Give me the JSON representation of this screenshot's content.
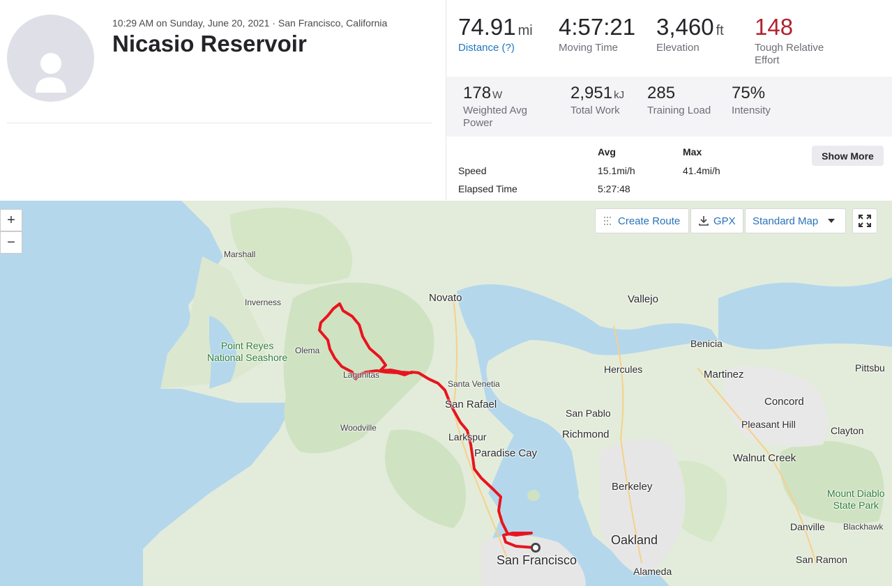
{
  "activity": {
    "meta": "10:29 AM on Sunday, June 20, 2021 · San Francisco, California",
    "title": "Nicasio Reservoir"
  },
  "stats_primary": [
    {
      "value": "74.91",
      "unit": "mi",
      "label": "Distance (?)"
    },
    {
      "value": "4:57:21",
      "unit": "",
      "label": "Moving Time"
    },
    {
      "value": "3,460",
      "unit": "ft",
      "label": "Elevation"
    },
    {
      "value": "148",
      "unit": "",
      "label_line1": "Tough Relative",
      "label_line2": "Effort"
    }
  ],
  "stats_secondary": [
    {
      "value": "178",
      "unit": "W",
      "label_line1": "Weighted Avg",
      "label_line2": "Power"
    },
    {
      "value": "2,951",
      "unit": "kJ",
      "label": "Total Work"
    },
    {
      "value": "285",
      "unit": "",
      "label": "Training Load"
    },
    {
      "value": "75%",
      "unit": "",
      "label": "Intensity"
    }
  ],
  "more_stats": {
    "col_avg": "Avg",
    "col_max": "Max",
    "rows": [
      {
        "label": "Speed",
        "avg": "15.1mi/h",
        "max": "41.4mi/h"
      },
      {
        "label": "Elapsed Time",
        "avg": "5:27:48",
        "max": ""
      }
    ],
    "show_more": "Show More"
  },
  "map_controls": {
    "zoom_in": "+",
    "zoom_out": "−",
    "create_route": "Create Route",
    "gpx": "GPX",
    "map_type": "Standard Map"
  },
  "map_labels": {
    "marshall": "Marshall",
    "inverness": "Inverness",
    "point_reyes_1": "Point Reyes",
    "point_reyes_2": "National Seashore",
    "olema": "Olema",
    "lagunitas": "Lagunitas",
    "woodville": "Woodville",
    "novato": "Novato",
    "santa_venetia": "Santa Venetia",
    "san_rafael": "San Rafael",
    "larkspur": "Larkspur",
    "paradise_cay": "Paradise Cay",
    "san_francisco": "San Francisco",
    "vallejo": "Vallejo",
    "benicia": "Benicia",
    "hercules": "Hercules",
    "martinez": "Martinez",
    "pittsburg": "Pittsbu",
    "concord": "Concord",
    "pleasant_hill": "Pleasant Hill",
    "clayton": "Clayton",
    "san_pablo": "San Pablo",
    "richmond": "Richmond",
    "walnut_creek": "Walnut Creek",
    "berkeley": "Berkeley",
    "mount_diablo_1": "Mount Diablo",
    "mount_diablo_2": "State Park",
    "oakland": "Oakland",
    "danville": "Danville",
    "blackhawk": "Blackhawk",
    "san_ramon": "San Ramon",
    "alameda": "Alameda"
  },
  "colors": {
    "route": "#e8141e",
    "link": "#1e76c2",
    "suffer": "#b1232e",
    "water": "#b4d7ec",
    "land": "#e8efe3"
  }
}
